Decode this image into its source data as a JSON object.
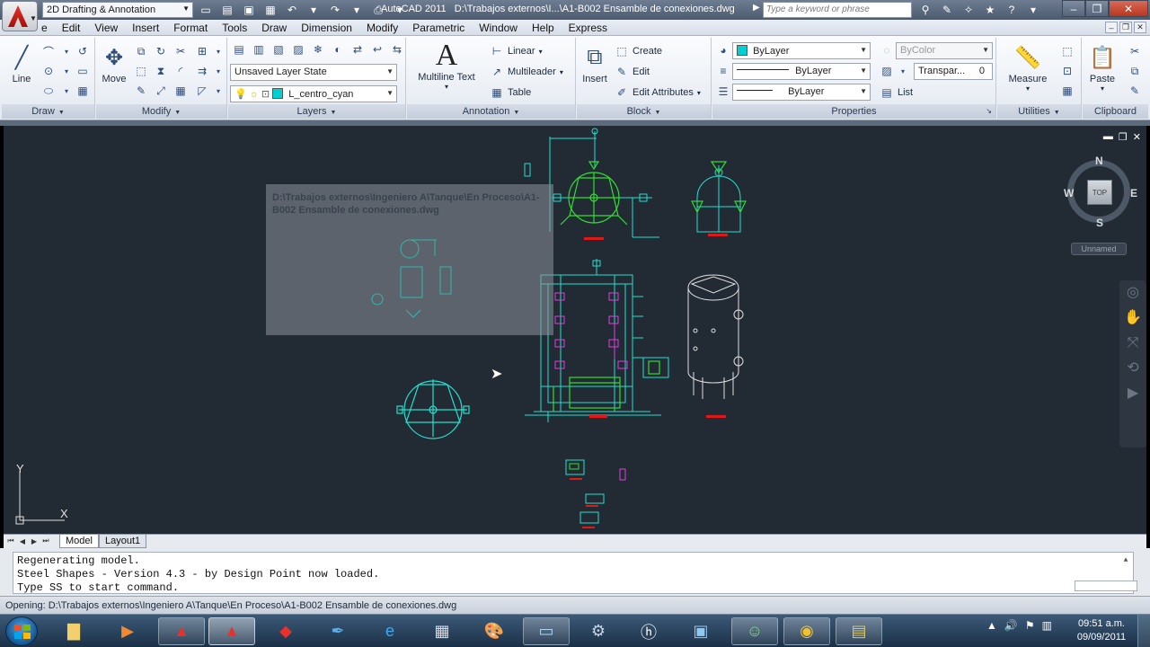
{
  "titlebar": {
    "workspace": "2D Drafting & Annotation",
    "app_title": "AutoCAD 2011",
    "document": "D:\\Trabajos externos\\I...\\A1-B002 Ensamble de conexiones.dwg",
    "search_placeholder": "Type a keyword or phrase"
  },
  "menu": [
    "e",
    "Edit",
    "View",
    "Insert",
    "Format",
    "Tools",
    "Draw",
    "Dimension",
    "Modify",
    "Parametric",
    "Window",
    "Help",
    "Express"
  ],
  "ribbon": {
    "draw": {
      "title": "Draw",
      "line": "Line"
    },
    "modify": {
      "title": "Modify",
      "move": "Move"
    },
    "layers": {
      "title": "Layers",
      "layer_state": "Unsaved Layer State",
      "current_layer": "L_centro_cyan",
      "layer_color": "#00d0d0"
    },
    "annotation": {
      "title": "Annotation",
      "mtext": "Multiline Text",
      "linear": "Linear",
      "multileader": "Multileader",
      "table": "Table"
    },
    "block": {
      "title": "Block",
      "insert": "Insert",
      "create": "Create",
      "edit": "Edit",
      "edit_attributes": "Edit Attributes"
    },
    "properties": {
      "title": "Properties",
      "color": "ByLayer",
      "linetype": "ByLayer",
      "lineweight": "ByLayer",
      "plot_style": "ByColor",
      "transparency": "Transpar...",
      "transparency_value": "0",
      "list": "List"
    },
    "utilities": {
      "title": "Utilities",
      "measure": "Measure"
    },
    "clipboard": {
      "title": "Clipboard",
      "paste": "Paste"
    }
  },
  "viewport": {
    "preview_path": "D:\\Trabajos externos\\Ingeniero A\\Tanque\\En Proceso\\A1-B002 Ensamble de conexiones.dwg",
    "viewcube": {
      "n": "N",
      "s": "S",
      "e": "E",
      "w": "W",
      "face": "TOP"
    },
    "wcs": "Unnamed",
    "ucs_y": "Y",
    "ucs_x": "X"
  },
  "tabs": {
    "model": "Model",
    "layout1": "Layout1"
  },
  "command_lines": [
    "Regenerating model.",
    "Steel Shapes - Version 4.3 - by Design Point now loaded.",
    "Type SS to start command."
  ],
  "status": "Opening: D:\\Trabajos externos\\Ingeniero A\\Tanque\\En Proceso\\A1-B002 Ensamble de conexiones.dwg",
  "clock": {
    "time": "09:51 a.m.",
    "date": "09/09/2011"
  },
  "colors": {
    "drawing_bg": "#222a34",
    "cyan": "#22e0d0",
    "green": "#33dd33",
    "magenta": "#e040e0",
    "red": "#e01818",
    "white": "#e0e0e0"
  }
}
